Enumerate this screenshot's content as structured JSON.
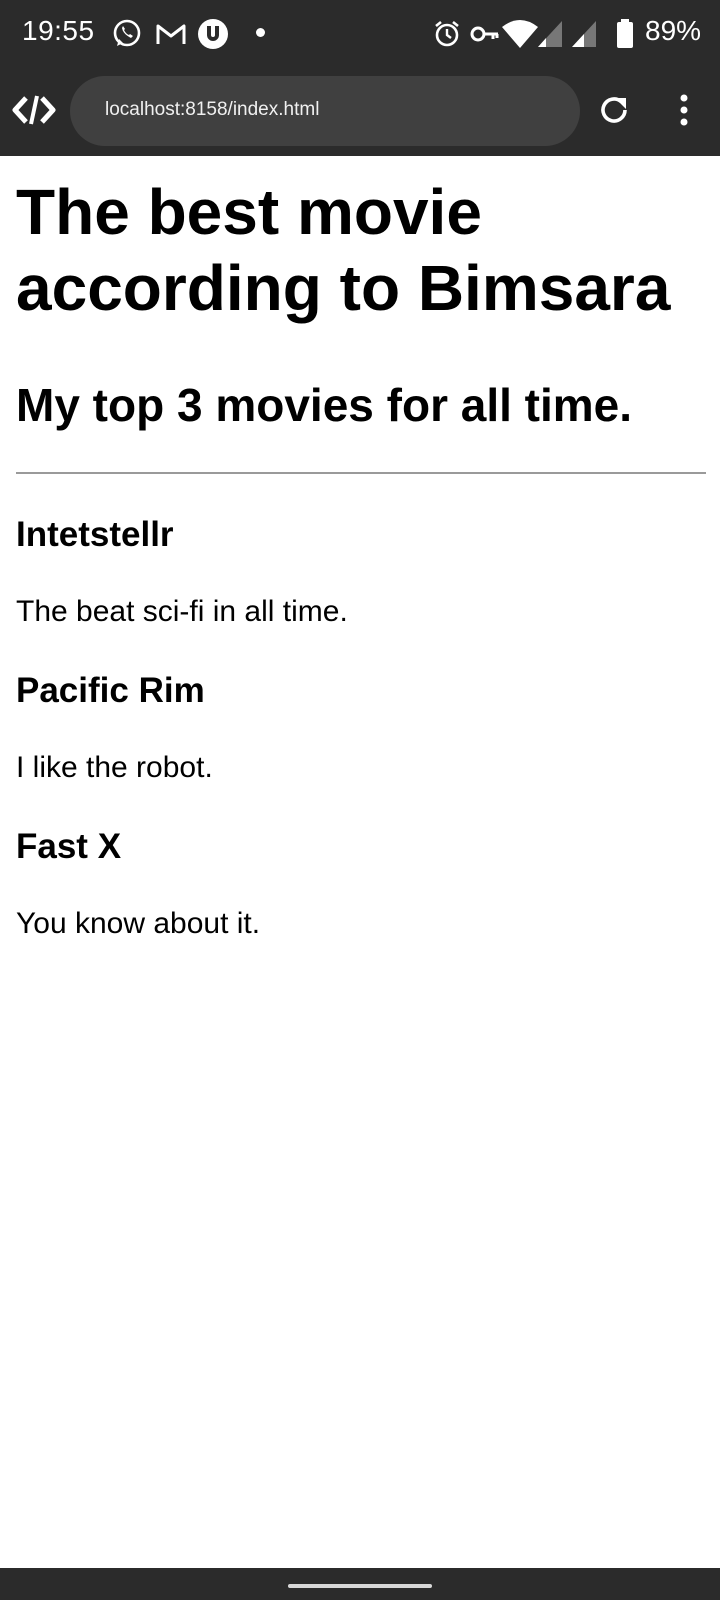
{
  "status_bar": {
    "time": "19:55",
    "battery_percent": "89%",
    "notification_icons": [
      "whatsapp-icon",
      "gmail-icon",
      "vpn-shield-icon",
      "more-dot-icon"
    ],
    "system_icons": [
      "alarm-icon",
      "key-icon",
      "wifi-icon",
      "signal-icon",
      "signal-icon",
      "battery-icon"
    ]
  },
  "browser": {
    "url": "localhost:8158/index.html",
    "left_icon": "devtools-icon",
    "reload_icon": "reload-icon",
    "menu_icon": "overflow-menu-icon"
  },
  "page": {
    "title": "The best movie according to Bimsara",
    "subtitle": "My top 3 movies for all time.",
    "movies": [
      {
        "name": "Intetstellr",
        "description": "The beat sci-fi in all time."
      },
      {
        "name": "Pacific Rim",
        "description": "I like the robot."
      },
      {
        "name": "Fast X",
        "description": "You know about it."
      }
    ]
  }
}
